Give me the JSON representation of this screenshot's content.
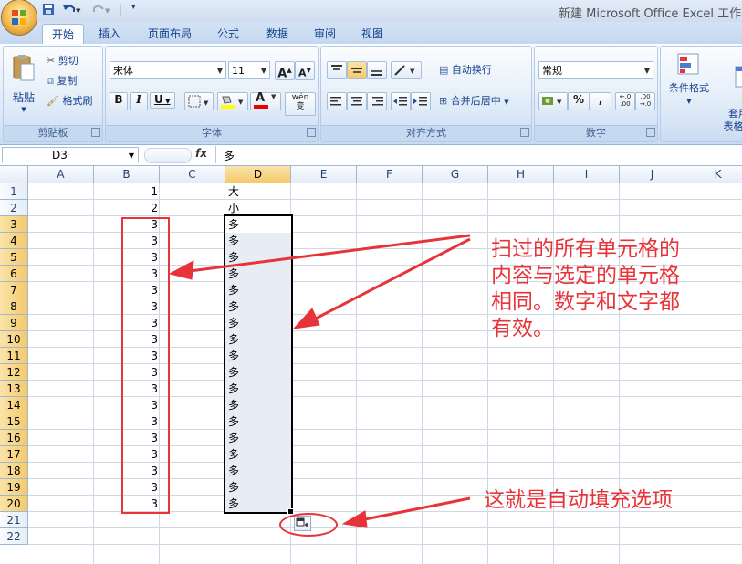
{
  "window": {
    "title": "新建 Microsoft Office Excel 工作"
  },
  "quick_access": {
    "save_icon": "save-icon",
    "undo_icon": "undo-icon",
    "redo_icon": "redo-icon",
    "customize_icon": "customize-icon"
  },
  "tabs": [
    "开始",
    "插入",
    "页面布局",
    "公式",
    "数据",
    "审阅",
    "视图"
  ],
  "ribbon": {
    "clipboard": {
      "paste": "粘贴",
      "cut": "剪切",
      "copy": "复制",
      "format_painter": "格式刷",
      "label": "剪贴板"
    },
    "font": {
      "font_name": "宋体",
      "font_size": "11",
      "bold": "B",
      "italic": "I",
      "underline": "U",
      "grow": "A",
      "shrink": "A",
      "color_a": "A",
      "phonetic": "wén\n变",
      "label": "字体"
    },
    "alignment": {
      "wrap": "自动换行",
      "merge": "合并后居中",
      "label": "对齐方式"
    },
    "number": {
      "format": "常规",
      "percent": "%",
      "comma": ",",
      "label": "数字"
    },
    "styles": {
      "conditional": "条件格式",
      "table_format": "套用\n表格格"
    }
  },
  "formula_bar": {
    "name_box": "D3",
    "fx": "fx",
    "value": "多"
  },
  "columns": [
    "A",
    "B",
    "C",
    "D",
    "E",
    "F",
    "G",
    "H",
    "I",
    "J",
    "K"
  ],
  "selected_column": "D",
  "rows": [
    "1",
    "2",
    "3",
    "4",
    "5",
    "6",
    "7",
    "8",
    "9",
    "10",
    "11",
    "12",
    "13",
    "14",
    "15",
    "16",
    "17",
    "18",
    "19",
    "20",
    "21",
    "22"
  ],
  "cells": {
    "B": [
      "1",
      "2",
      "3",
      "3",
      "3",
      "3",
      "3",
      "3",
      "3",
      "3",
      "3",
      "3",
      "3",
      "3",
      "3",
      "3",
      "3",
      "3",
      "3",
      "3"
    ],
    "D": [
      "大",
      "小",
      "多",
      "多",
      "多",
      "多",
      "多",
      "多",
      "多",
      "多",
      "多",
      "多",
      "多",
      "多",
      "多",
      "多",
      "多",
      "多",
      "多",
      "多"
    ]
  },
  "annotations": {
    "main": "扫过的所有单元格的内容与选定的单元格相同。数字和文字都有效。",
    "main_lines": [
      "扫过的所有单元格的",
      "内容与选定的单元格",
      "相同。数字和文字都",
      "有效。"
    ],
    "autofill": "这就是自动填充选项"
  },
  "colors": {
    "annotation": "#e8333a",
    "selection_fill": "#e8ecf5",
    "header_selected": "#f5c96b"
  }
}
